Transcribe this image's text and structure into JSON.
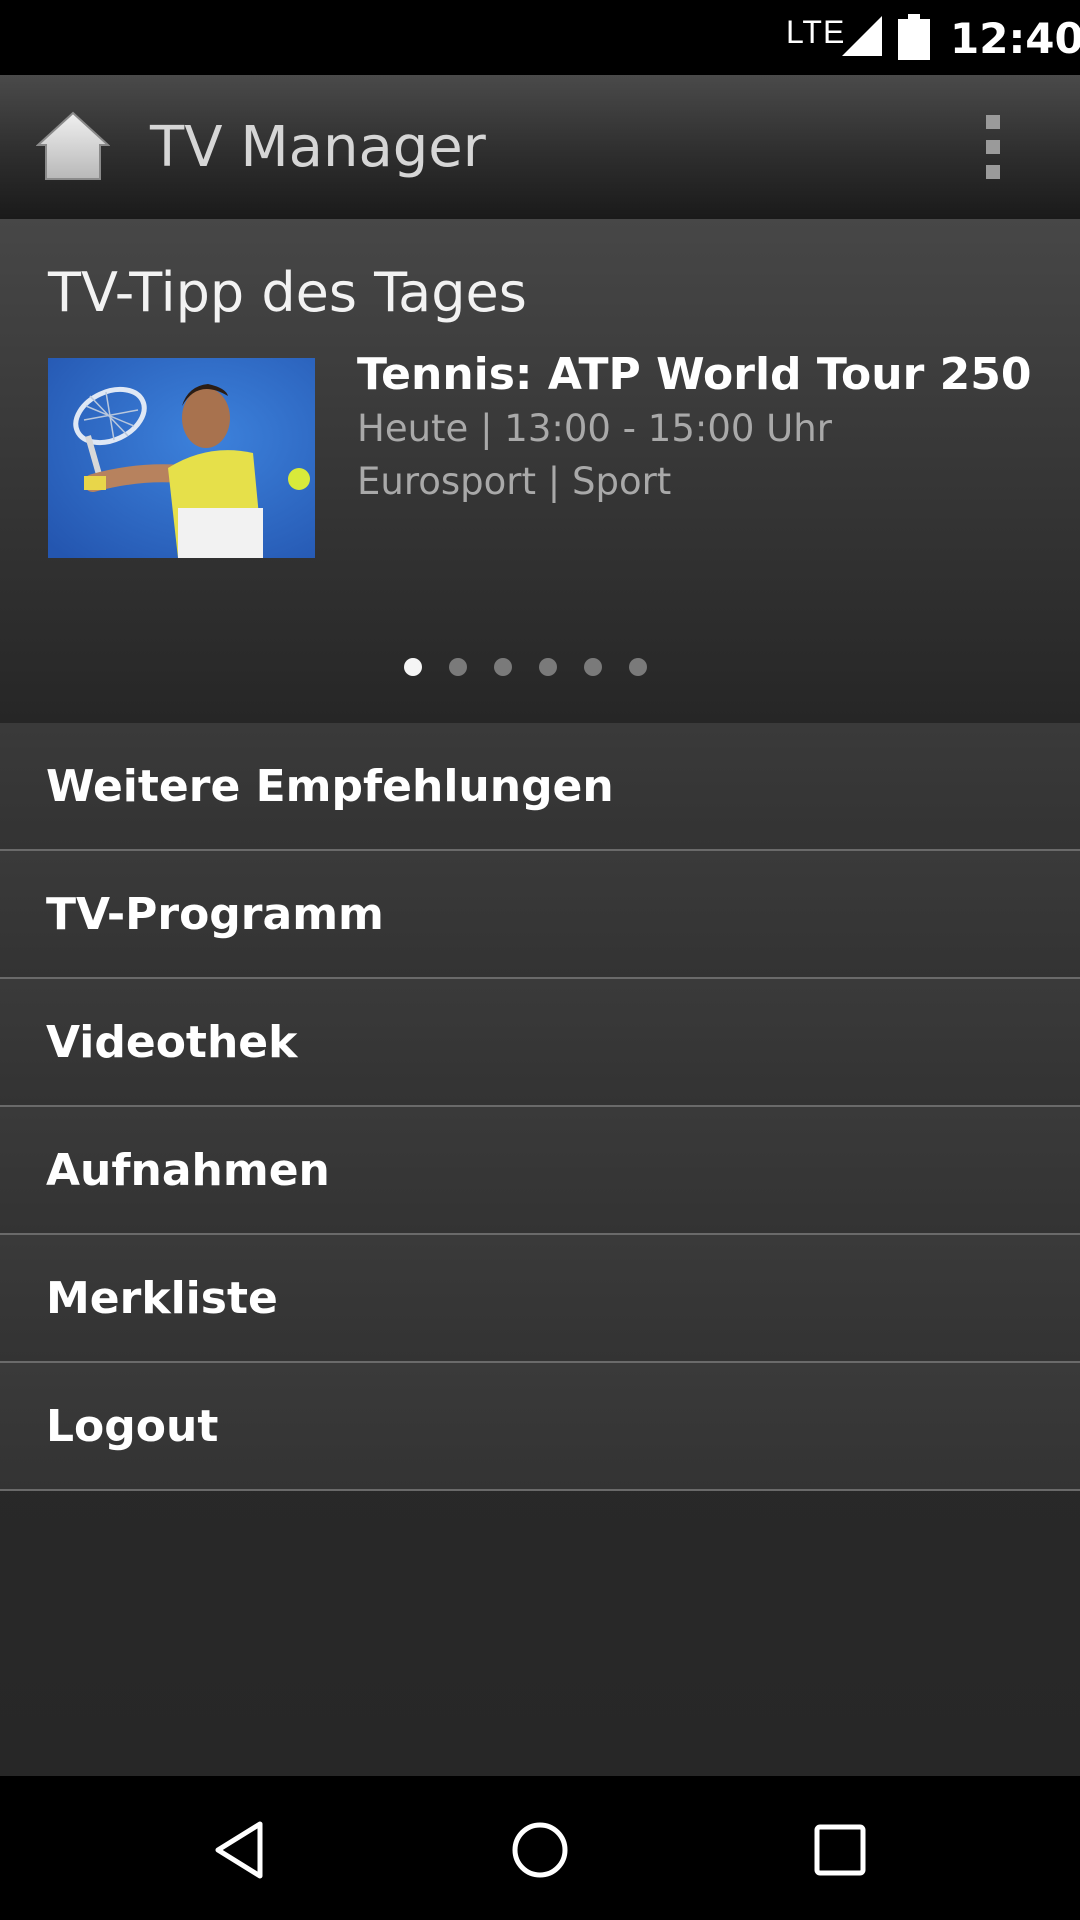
{
  "status_bar": {
    "network": "LTE",
    "time": "12:40"
  },
  "action_bar": {
    "title": "TV Manager",
    "home_icon": "home-icon",
    "overflow_icon": "more-vert-icon"
  },
  "tip": {
    "heading": "TV-Tipp des Tages",
    "title": "Tennis: ATP World Tour 250 -…",
    "time": "Heute | 13:00 - 15:00 Uhr",
    "channel": "Eurosport | Sport",
    "pager": {
      "count": 6,
      "active_index": 0
    }
  },
  "menu": {
    "items": [
      {
        "label": "Weitere Empfehlungen"
      },
      {
        "label": "TV-Programm"
      },
      {
        "label": "Videothek"
      },
      {
        "label": "Aufnahmen"
      },
      {
        "label": "Merkliste"
      },
      {
        "label": "Logout"
      }
    ]
  },
  "nav_bar": {
    "back_icon": "back-icon",
    "home_icon": "home-circle-icon",
    "recent_icon": "recent-apps-icon"
  },
  "colors": {
    "status_bar_bg": "#000000",
    "text_primary": "#ffffff",
    "text_secondary": "#a9a9a9",
    "divider": "#6a6a6a"
  }
}
